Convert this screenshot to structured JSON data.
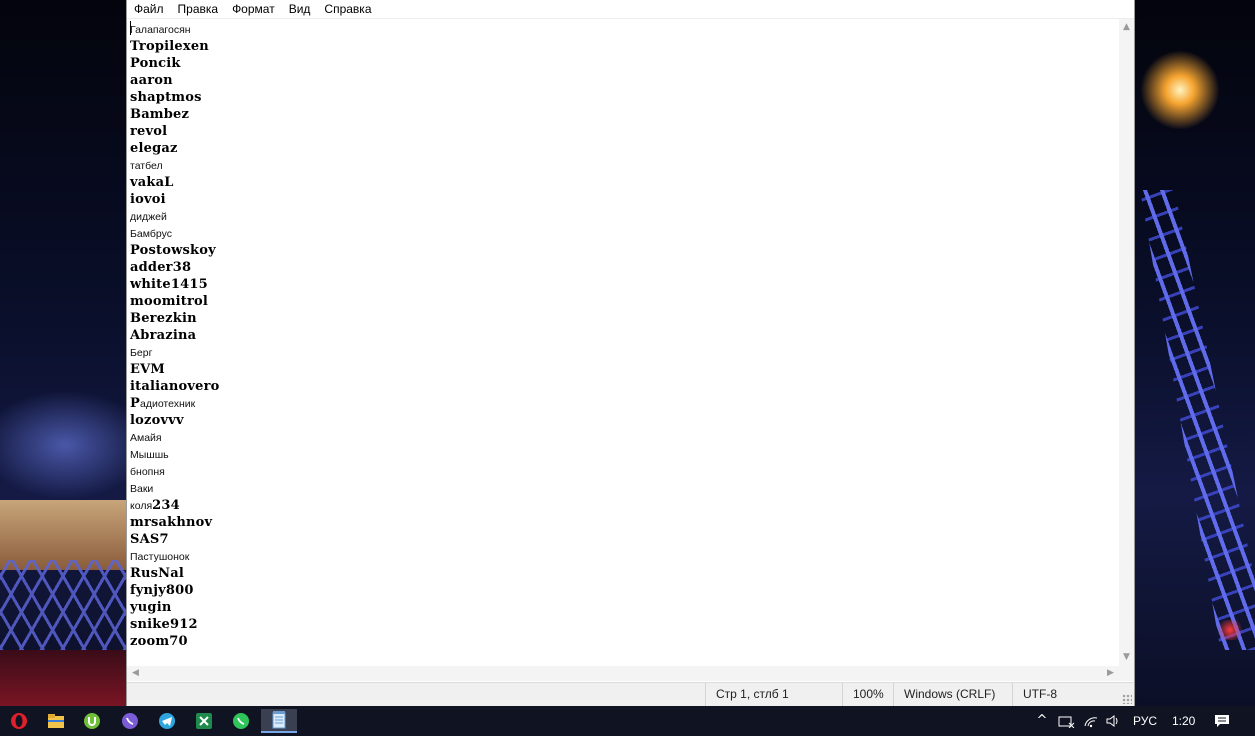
{
  "menu": {
    "items": [
      "Файл",
      "Правка",
      "Формат",
      "Вид",
      "Справка"
    ]
  },
  "editor": {
    "lines": [
      [
        {
          "t": "Галапагосян",
          "s": "plain"
        }
      ],
      [
        {
          "t": "Tropilexen",
          "s": "bold"
        }
      ],
      [
        {
          "t": "Poncik",
          "s": "bold"
        }
      ],
      [
        {
          "t": "aaron",
          "s": "bold"
        }
      ],
      [
        {
          "t": "shaptmos",
          "s": "bold"
        }
      ],
      [
        {
          "t": "Bambez",
          "s": "bold"
        }
      ],
      [
        {
          "t": "revol",
          "s": "bold"
        }
      ],
      [
        {
          "t": "elegaz",
          "s": "bold"
        }
      ],
      [
        {
          "t": "татбел",
          "s": "plain"
        }
      ],
      [
        {
          "t": "vakaL",
          "s": "bold"
        }
      ],
      [
        {
          "t": "iovoi",
          "s": "bold"
        }
      ],
      [
        {
          "t": "диджей",
          "s": "plain"
        }
      ],
      [
        {
          "t": "Бамбрус",
          "s": "plain"
        }
      ],
      [
        {
          "t": "Postowskoy",
          "s": "bold"
        }
      ],
      [
        {
          "t": "adder38",
          "s": "bold"
        }
      ],
      [
        {
          "t": "white1415",
          "s": "bold"
        }
      ],
      [
        {
          "t": "moomitrol",
          "s": "bold"
        }
      ],
      [
        {
          "t": "Berezkin",
          "s": "bold"
        }
      ],
      [
        {
          "t": "Abrazina",
          "s": "bold"
        }
      ],
      [
        {
          "t": "Берг",
          "s": "plain"
        }
      ],
      [
        {
          "t": "EVM",
          "s": "bold"
        }
      ],
      [
        {
          "t": "italianovero",
          "s": "bold"
        }
      ],
      [
        {
          "t": "P",
          "s": "bold"
        },
        {
          "t": "адиотехник",
          "s": "plain"
        }
      ],
      [
        {
          "t": "lozovvv",
          "s": "bold"
        }
      ],
      [
        {
          "t": "Амайя",
          "s": "plain"
        }
      ],
      [
        {
          "t": "Мышшь",
          "s": "plain"
        }
      ],
      [
        {
          "t": "бнопня",
          "s": "plain"
        }
      ],
      [
        {
          "t": "Ваки",
          "s": "plain"
        }
      ],
      [
        {
          "t": "коля",
          "s": "plain"
        },
        {
          "t": "234",
          "s": "bold"
        }
      ],
      [
        {
          "t": "mrsakhnov",
          "s": "bold"
        }
      ],
      [
        {
          "t": "SAS7",
          "s": "bold"
        }
      ],
      [
        {
          "t": "Пастушонок",
          "s": "plain"
        }
      ],
      [
        {
          "t": "RusNal",
          "s": "bold"
        }
      ],
      [
        {
          "t": "fynjy800",
          "s": "bold"
        }
      ],
      [
        {
          "t": "yugin",
          "s": "bold"
        }
      ],
      [
        {
          "t": "snike912",
          "s": "bold"
        }
      ],
      [
        {
          "t": "zoom70",
          "s": "bold"
        }
      ]
    ]
  },
  "status": {
    "position": "Стр 1, стлб 1",
    "zoom": "100%",
    "line_ending": "Windows (CRLF)",
    "encoding": "UTF-8"
  },
  "taskbar": {
    "apps": [
      {
        "name": "opera-icon",
        "color": "#e0202a"
      },
      {
        "name": "file-explorer-icon",
        "color": "#f2c54a"
      },
      {
        "name": "utorrent-icon",
        "color": "#6fbf3a"
      },
      {
        "name": "viber-icon",
        "color": "#7b5bd6"
      },
      {
        "name": "telegram-icon",
        "color": "#2ea6dd"
      },
      {
        "name": "excel-icon",
        "color": "#1f8a4c"
      },
      {
        "name": "whatsapp-icon",
        "color": "#2fc55b"
      },
      {
        "name": "notepad-icon",
        "color": "#9cc8f0"
      }
    ],
    "tray": {
      "language": "РУС",
      "time": "1:20"
    }
  }
}
